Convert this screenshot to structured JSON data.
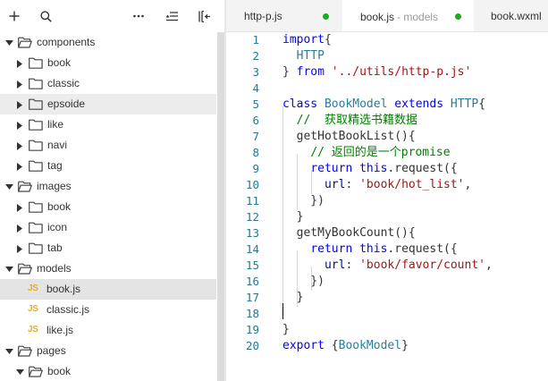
{
  "toolbar": {
    "add_icon": "plus-icon",
    "search_icon": "search-icon",
    "more_icon": "more-horizontal-icon",
    "sort_icon": "sort-icon",
    "collapse_icon": "collapse-sidebar-icon"
  },
  "tree": [
    {
      "label": "components",
      "depth": 0,
      "kind": "folder",
      "open": true,
      "state": ""
    },
    {
      "label": "book",
      "depth": 1,
      "kind": "folder",
      "open": false,
      "state": ""
    },
    {
      "label": "classic",
      "depth": 1,
      "kind": "folder",
      "open": false,
      "state": ""
    },
    {
      "label": "epsoide",
      "depth": 1,
      "kind": "folder",
      "open": false,
      "state": "hover"
    },
    {
      "label": "like",
      "depth": 1,
      "kind": "folder",
      "open": false,
      "state": ""
    },
    {
      "label": "navi",
      "depth": 1,
      "kind": "folder",
      "open": false,
      "state": ""
    },
    {
      "label": "tag",
      "depth": 1,
      "kind": "folder",
      "open": false,
      "state": ""
    },
    {
      "label": "images",
      "depth": 0,
      "kind": "folder",
      "open": true,
      "state": ""
    },
    {
      "label": "book",
      "depth": 1,
      "kind": "folder",
      "open": false,
      "state": ""
    },
    {
      "label": "icon",
      "depth": 1,
      "kind": "folder",
      "open": false,
      "state": ""
    },
    {
      "label": "tab",
      "depth": 1,
      "kind": "folder",
      "open": false,
      "state": ""
    },
    {
      "label": "models",
      "depth": 0,
      "kind": "folder",
      "open": true,
      "state": ""
    },
    {
      "label": "book.js",
      "depth": 1,
      "kind": "js",
      "open": false,
      "state": "selected"
    },
    {
      "label": "classic.js",
      "depth": 1,
      "kind": "js",
      "open": false,
      "state": ""
    },
    {
      "label": "like.js",
      "depth": 1,
      "kind": "js",
      "open": false,
      "state": ""
    },
    {
      "label": "pages",
      "depth": 0,
      "kind": "folder",
      "open": true,
      "state": ""
    },
    {
      "label": "book",
      "depth": 1,
      "kind": "folder",
      "open": true,
      "state": ""
    }
  ],
  "js_badge": "JS",
  "tabs": [
    {
      "name": "http-p.js",
      "desc": "",
      "active": false,
      "dot": true
    },
    {
      "name": "book.js",
      "desc": "- models",
      "active": true,
      "dot": true
    },
    {
      "name": "book.wxml",
      "desc": "",
      "active": false,
      "dot": false
    }
  ],
  "colors": {
    "modified_dot": "#1aad19",
    "keyword": "#0000ff",
    "class_name": "#267f99",
    "string": "#a31515",
    "comment": "#008000",
    "line_number": "#237893",
    "js_icon": "#e3b21b"
  },
  "code_lines": [
    {
      "n": "1",
      "tokens": [
        [
          "kw",
          "import"
        ],
        [
          "",
          "{"
        ]
      ]
    },
    {
      "n": "2",
      "tokens": [
        [
          "",
          "  "
        ],
        [
          "cls",
          "HTTP"
        ]
      ]
    },
    {
      "n": "3",
      "tokens": [
        [
          "",
          "} "
        ],
        [
          "kw",
          "from"
        ],
        [
          "",
          " "
        ],
        [
          "str",
          "'../utils/http-p.js'"
        ]
      ]
    },
    {
      "n": "4",
      "tokens": []
    },
    {
      "n": "5",
      "tokens": [
        [
          "kw",
          "class"
        ],
        [
          "",
          " "
        ],
        [
          "cls",
          "BookModel"
        ],
        [
          "",
          " "
        ],
        [
          "kw",
          "extends"
        ],
        [
          "",
          " "
        ],
        [
          "cls",
          "HTTP"
        ],
        [
          "",
          "{"
        ]
      ]
    },
    {
      "n": "6",
      "tokens": [
        [
          "",
          "  "
        ],
        [
          "cmt",
          "//  获取精选书籍数据"
        ]
      ]
    },
    {
      "n": "7",
      "tokens": [
        [
          "",
          "  "
        ],
        [
          "fn",
          "getHotBookList"
        ],
        [
          "",
          "(){"
        ]
      ]
    },
    {
      "n": "8",
      "tokens": [
        [
          "",
          "    "
        ],
        [
          "cmt",
          "// 返回的是一个promise"
        ]
      ]
    },
    {
      "n": "9",
      "tokens": [
        [
          "",
          "    "
        ],
        [
          "kw",
          "return"
        ],
        [
          "",
          " "
        ],
        [
          "kw",
          "this"
        ],
        [
          "",
          ".request({"
        ]
      ]
    },
    {
      "n": "10",
      "tokens": [
        [
          "",
          "      "
        ],
        [
          "prop",
          "url"
        ],
        [
          "",
          ": "
        ],
        [
          "str",
          "'book/hot_list'"
        ],
        [
          "",
          ","
        ]
      ]
    },
    {
      "n": "11",
      "tokens": [
        [
          "",
          "    })"
        ]
      ]
    },
    {
      "n": "12",
      "tokens": [
        [
          "",
          "  }"
        ]
      ]
    },
    {
      "n": "13",
      "tokens": [
        [
          "",
          "  "
        ],
        [
          "fn",
          "getMyBookCount"
        ],
        [
          "",
          "(){"
        ]
      ]
    },
    {
      "n": "14",
      "tokens": [
        [
          "",
          "    "
        ],
        [
          "kw",
          "return"
        ],
        [
          "",
          " "
        ],
        [
          "kw",
          "this"
        ],
        [
          "",
          ".request({"
        ]
      ]
    },
    {
      "n": "15",
      "tokens": [
        [
          "",
          "      "
        ],
        [
          "prop",
          "url"
        ],
        [
          "",
          ": "
        ],
        [
          "str",
          "'book/favor/count'"
        ],
        [
          "",
          ","
        ]
      ]
    },
    {
      "n": "16",
      "tokens": [
        [
          "",
          "    })"
        ]
      ]
    },
    {
      "n": "17",
      "tokens": [
        [
          "",
          "  }"
        ]
      ]
    },
    {
      "n": "18",
      "tokens": []
    },
    {
      "n": "19",
      "tokens": [
        [
          "",
          "}"
        ]
      ]
    },
    {
      "n": "20",
      "tokens": [
        [
          "kw",
          "export"
        ],
        [
          "",
          " {"
        ],
        [
          "cls",
          "BookModel"
        ],
        [
          "",
          "}"
        ]
      ]
    }
  ]
}
